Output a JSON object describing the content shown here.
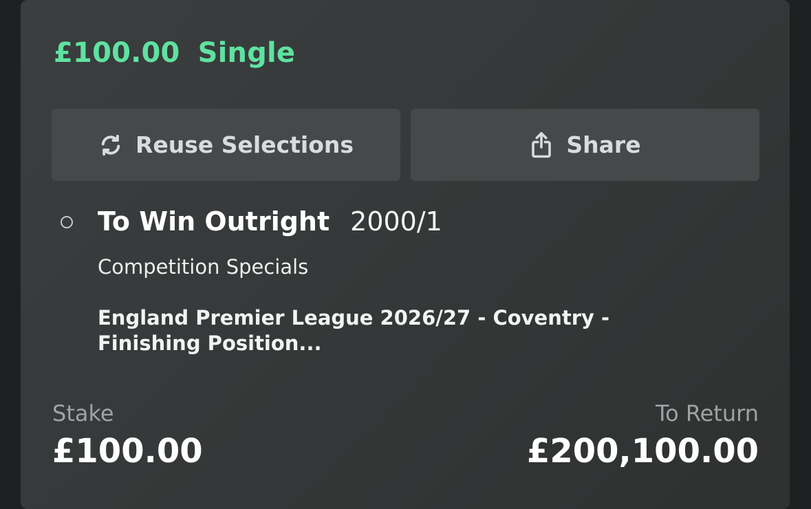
{
  "bet": {
    "amount": "£100.00",
    "type": "Single"
  },
  "actions": {
    "reuse_label": "Reuse Selections",
    "reuse_icon": "refresh-icon",
    "share_label": "Share",
    "share_icon": "share-icon"
  },
  "selection": {
    "market": "To Win Outright",
    "odds": "2000/1",
    "category": "Competition Specials",
    "event": "England Premier League 2026/27 - Coventry - Finishing Position..."
  },
  "summary": {
    "stake_label": "Stake",
    "stake_value": "£100.00",
    "return_label": "To Return",
    "return_value": "£200,100.00"
  },
  "colors": {
    "accent": "#5fe2a0",
    "card_background": "#3b3e3f",
    "button_background": "#454949",
    "page_background": "#1f2021"
  }
}
